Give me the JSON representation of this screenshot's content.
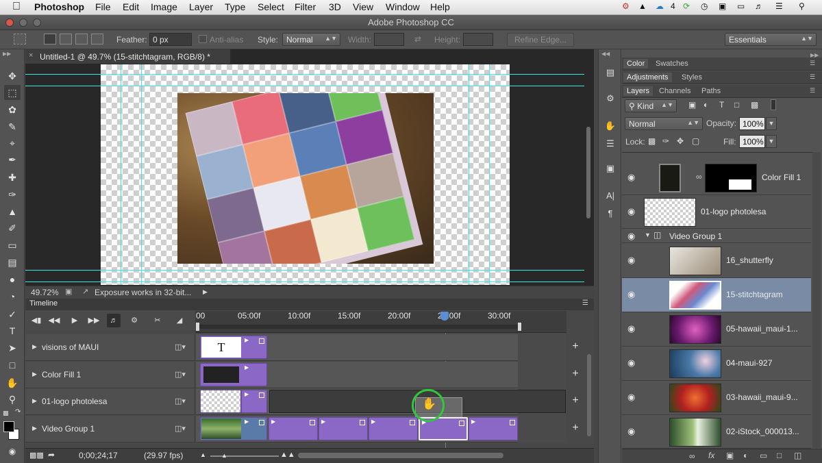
{
  "menubar": {
    "apple": "",
    "app_name": "Photoshop",
    "items": [
      "File",
      "Edit",
      "Image",
      "Layer",
      "Type",
      "Select",
      "Filter",
      "3D",
      "View",
      "Window",
      "Help"
    ],
    "status_badge": "4"
  },
  "window": {
    "title": "Adobe Photoshop CC"
  },
  "options": {
    "feather_label": "Feather:",
    "feather_value": "0 px",
    "antialias_label": "Anti-alias",
    "style_label": "Style:",
    "style_value": "Normal",
    "width_label": "Width:",
    "height_label": "Height:",
    "refine_edge_label": "Refine Edge...",
    "workspace_value": "Essentials"
  },
  "document": {
    "tab_title": "Untitled-1 @ 49.7% (15-stitchtagram, RGB/8) *",
    "zoom": "49.72%",
    "status_text": "Exposure works in 32-bit..."
  },
  "timeline": {
    "panel_title": "Timeline",
    "ruler_labels": [
      "00",
      "05:00f",
      "10:00f",
      "15:00f",
      "20:00f",
      "25:00f",
      "30:00f"
    ],
    "tracks": [
      {
        "name": "visions of MAUI"
      },
      {
        "name": "Color Fill 1"
      },
      {
        "name": "01-logo photolesa"
      },
      {
        "name": "Video Group 1"
      }
    ],
    "text_clip_glyph": "T",
    "current_time": "0;00;24;17",
    "fps": "(29.97 fps)"
  },
  "panels": {
    "color_tab": "Color",
    "swatches_tab": "Swatches",
    "adjustments_tab": "Adjustments",
    "styles_tab": "Styles",
    "layers_tab": "Layers",
    "channels_tab": "Channels",
    "paths_tab": "Paths",
    "filter_kind": "Kind",
    "blend_mode": "Normal",
    "opacity_label": "Opacity:",
    "opacity_value": "100%",
    "lock_label": "Lock:",
    "fill_label": "Fill:",
    "fill_value": "100%"
  },
  "layers": [
    {
      "name": "Color Fill 1"
    },
    {
      "name": "01-logo photolesa"
    },
    {
      "name": "Video Group 1"
    },
    {
      "name": "16_shutterfly"
    },
    {
      "name": "15-stitchtagram"
    },
    {
      "name": "05-hawaii_maui-1..."
    },
    {
      "name": "04-maui-927"
    },
    {
      "name": "03-hawaii_maui-9..."
    },
    {
      "name": "02-iStock_000013..."
    }
  ],
  "colors": {
    "clip_purple": "#8c68c6",
    "guide_cyan": "#3ee7e7",
    "selected_layer": "#7a8ba5",
    "cursor_ring": "#2ec83a"
  }
}
